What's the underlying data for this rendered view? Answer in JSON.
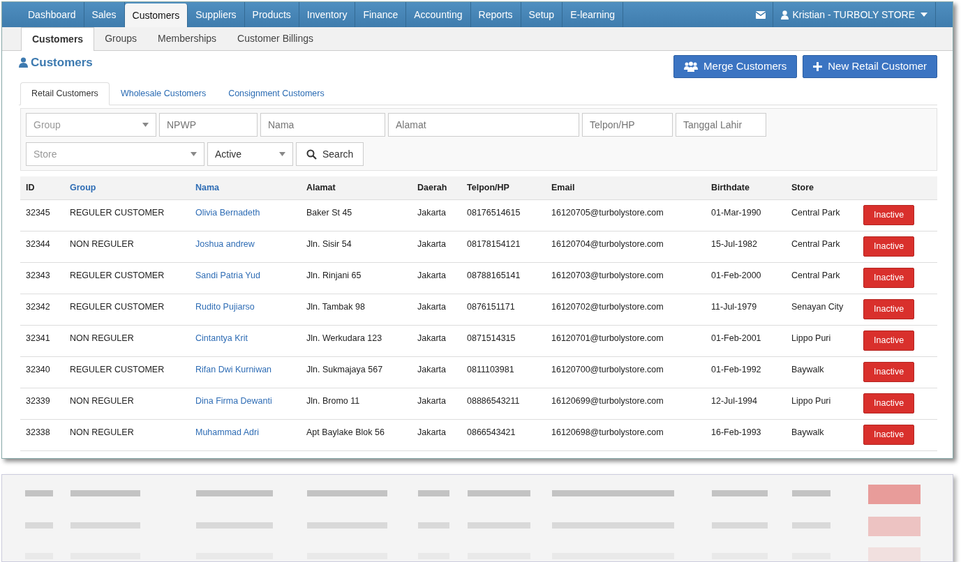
{
  "top_nav": {
    "items": [
      {
        "label": "Dashboard",
        "selected": false
      },
      {
        "label": "Sales",
        "selected": false
      },
      {
        "label": "Customers",
        "selected": true
      },
      {
        "label": "Suppliers",
        "selected": false
      },
      {
        "label": "Products",
        "selected": false
      },
      {
        "label": "Inventory",
        "selected": false
      },
      {
        "label": "Finance",
        "selected": false
      },
      {
        "label": "Accounting",
        "selected": false
      },
      {
        "label": "Reports",
        "selected": false
      },
      {
        "label": "Setup",
        "selected": false
      },
      {
        "label": "E-learning",
        "selected": false
      }
    ],
    "user": "Kristian - TURBOLY STORE"
  },
  "sub_nav": [
    {
      "label": "Customers",
      "selected": true
    },
    {
      "label": "Groups",
      "selected": false
    },
    {
      "label": "Memberships",
      "selected": false
    },
    {
      "label": "Customer Billings",
      "selected": false
    }
  ],
  "page_title": "Customers",
  "buttons": [
    "Merge Customers",
    "New Retail Customer"
  ],
  "tabs": [
    {
      "label": "Retail Customers",
      "selected": true
    },
    {
      "label": "Wholesale Customers",
      "selected": false
    },
    {
      "label": "Consignment Customers",
      "selected": false
    }
  ],
  "filters": {
    "row_1": [
      {
        "kind": "select",
        "placeholder": "Group"
      },
      {
        "kind": "input",
        "placeholder": "NPWP"
      },
      {
        "kind": "input",
        "placeholder": "Nama"
      },
      {
        "kind": "input",
        "placeholder": "Alamat"
      },
      {
        "kind": "input",
        "placeholder": "Telpon/HP"
      },
      {
        "kind": "input",
        "placeholder": "Tanggal Lahir"
      }
    ],
    "row_2": [
      {
        "kind": "select",
        "placeholder": "Store"
      },
      {
        "kind": "select",
        "value": "Active"
      }
    ],
    "search_button": "Search"
  },
  "table": {
    "columns": [
      {
        "label": "ID",
        "sortable": false
      },
      {
        "label": "Group",
        "sortable": true
      },
      {
        "label": "Nama",
        "sortable": true
      },
      {
        "label": "Alamat",
        "sortable": false
      },
      {
        "label": "Daerah",
        "sortable": false
      },
      {
        "label": "Telpon/HP",
        "sortable": false
      },
      {
        "label": "Email",
        "sortable": false
      },
      {
        "label": "Birthdate",
        "sortable": false
      },
      {
        "label": "Store",
        "sortable": false
      }
    ],
    "rows": [
      [
        "32345",
        "REGULER CUSTOMER",
        "Olivia Bernadeth",
        "Baker St 45",
        "Jakarta",
        "08176514615",
        "16120705@turbolystore.com",
        "01-Mar-1990",
        "Central Park",
        "Inactive"
      ],
      [
        "32344",
        "NON REGULER",
        "Joshua andrew",
        "Jln. Sisir 54",
        "Jakarta",
        "08178154121",
        "16120704@turbolystore.com",
        "15-Jul-1982",
        "Central Park",
        "Inactive"
      ],
      [
        "32343",
        "REGULER CUSTOMER",
        "Sandi Patria Yud",
        "Jln. Rinjani 65",
        "Jakarta",
        "08788165141",
        "16120703@turbolystore.com",
        "01-Feb-2000",
        "Central Park",
        "Inactive"
      ],
      [
        "32342",
        "REGULER CUSTOMER",
        "Rudito Pujiarso",
        "Jln. Tambak 98",
        "Jakarta",
        "0876151171",
        "16120702@turbolystore.com",
        "11-Jul-1979",
        "Senayan City",
        "Inactive"
      ],
      [
        "32341",
        "NON REGULER",
        "Cintantya Krit",
        "Jln. Werkudara 123",
        "Jakarta",
        "0871514315",
        "16120701@turbolystore.com",
        "01-Feb-2001",
        "Lippo Puri",
        "Inactive"
      ],
      [
        "32340",
        "REGULER CUSTOMER",
        "Rifan Dwi Kurniwan",
        "Jln. Sukmajaya 567",
        "Jakarta",
        "0811103981",
        "16120700@turbolystore.com",
        "01-Feb-1992",
        "Baywalk",
        "Inactive"
      ],
      [
        "32339",
        "NON REGULER",
        "Dina Firma Dewanti",
        "Jln. Bromo 11",
        "Jakarta",
        "08886543211",
        "16120699@turbolystore.com",
        "12-Jul-1994",
        "Lippo Puri",
        "Inactive"
      ],
      [
        "32338",
        "NON REGULER",
        "Muhammad Adri",
        "Apt Baylake Blok 56",
        "Jakarta",
        "0866543421",
        "16120698@turbolystore.com",
        "16-Feb-1993",
        "Baywalk",
        "Inactive"
      ]
    ]
  }
}
